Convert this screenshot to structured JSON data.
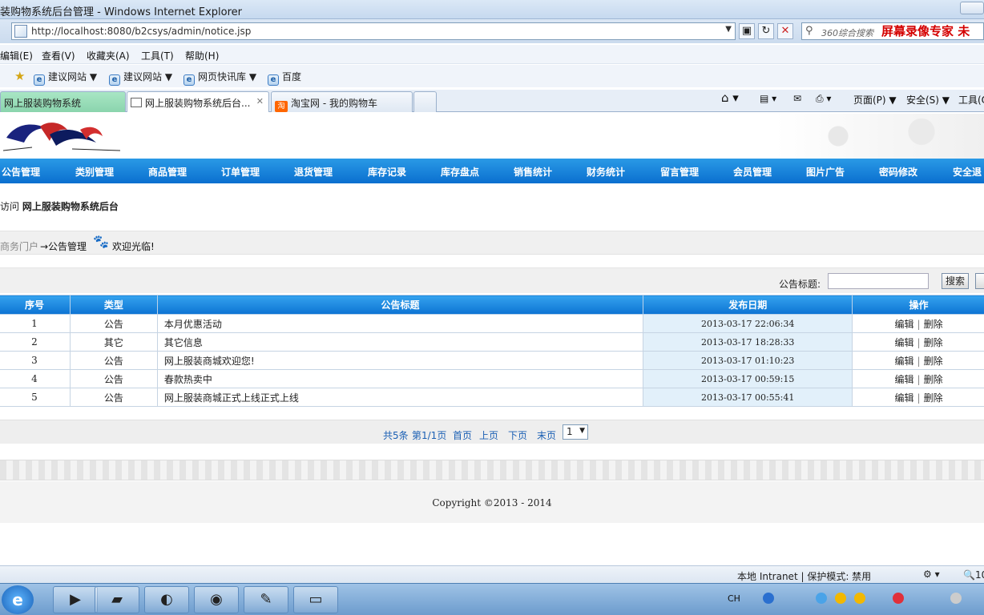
{
  "window": {
    "title": "装购物系统后台管理 - Windows Internet Explorer"
  },
  "address": {
    "url": "http://localhost:8080/b2csys/admin/notice.jsp",
    "search_placeholder": "360综合搜索",
    "overlay_text": "屏幕录像专家 未"
  },
  "menubar": {
    "items": [
      "编辑(E)",
      "查看(V)",
      "收藏夹(A)",
      "工具(T)",
      "帮助(H)"
    ]
  },
  "favorites": {
    "items": [
      "建议网站 ▼",
      "建议网站 ▼",
      "网页快讯库 ▼",
      "百度"
    ]
  },
  "tabs": [
    {
      "label": "网上服装购物系统"
    },
    {
      "label": "网上服装购物系统后台..."
    },
    {
      "label": "淘宝网 - 我的购物车"
    }
  ],
  "commandbar": {
    "items": [
      "页面(P) ▼",
      "安全(S) ▼",
      "工具(O)"
    ]
  },
  "nav": {
    "items": [
      "公告管理",
      "类别管理",
      "商品管理",
      "订单管理",
      "退货管理",
      "库存记录",
      "库存盘点",
      "销售统计",
      "财务统计",
      "留言管理",
      "会员管理",
      "图片广告",
      "密码修改",
      "安全退"
    ]
  },
  "welcome": {
    "prefix": "访问",
    "site": "网上服装购物系统后台"
  },
  "breadcrumb": {
    "root": "商务门户",
    "current": "→公告管理",
    "greeting": "欢迎光临!"
  },
  "search": {
    "label": "公告标题:",
    "value": "",
    "button": "搜索"
  },
  "table": {
    "headers": [
      "序号",
      "类型",
      "公告标题",
      "发布日期",
      "操作"
    ],
    "rows": [
      {
        "no": "1",
        "type": "公告",
        "title": "本月优惠活动",
        "date": "2013-03-17 22:06:34"
      },
      {
        "no": "2",
        "type": "其它",
        "title": "其它信息",
        "date": "2013-03-17 18:28:33"
      },
      {
        "no": "3",
        "type": "公告",
        "title": "网上服装商城欢迎您!",
        "date": "2013-03-17 01:10:23"
      },
      {
        "no": "4",
        "type": "公告",
        "title": "春款热卖中",
        "date": "2013-03-17 00:59:15"
      },
      {
        "no": "5",
        "type": "公告",
        "title": "网上服装商城正式上线正式上线",
        "date": "2013-03-17 00:55:41"
      }
    ],
    "edit_label": "编辑",
    "delete_label": "删除"
  },
  "pager": {
    "total": "共5条",
    "page": "第1/1页",
    "first": "首页",
    "prev": "上页",
    "next": "下页",
    "last": "末页",
    "select": "1"
  },
  "footer": {
    "copyright": "Copyright ©2013 - 2014"
  },
  "statusbar": {
    "zone": "本地 Intranet | 保护模式: 禁用",
    "zoom": "10"
  },
  "tray": {
    "lang": "CH"
  },
  "colors": {
    "nav_bg": "#0a6fcf",
    "date_cell": "#e2f0fa"
  }
}
